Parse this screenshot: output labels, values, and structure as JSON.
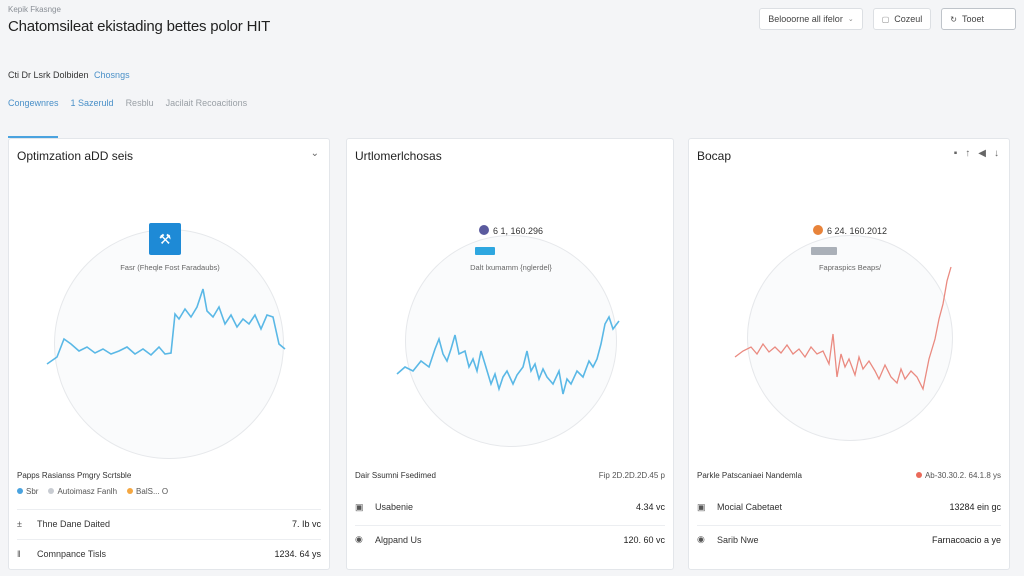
{
  "header": {
    "breadcrumb": "Kepik Fkasnge",
    "title": "Chatomsileat ekistading bettes polor HIT",
    "subline_text": "Cti Dr Lsrk Dolbiden",
    "subline_link": "Chosngs",
    "tabs": [
      "Congewnres",
      "1 Sazeruld",
      "Resblu",
      "Jacilait Recoacitions"
    ],
    "buttons": {
      "primary": "Belooorne all ifelor",
      "secondary": "Cozeul",
      "tertiary": "Tooet"
    }
  },
  "cards": [
    {
      "title": "Optimzation aDD seis",
      "center_label": "Fasr (Fheqle Fost Faradaubs)",
      "footer_title": "Papps Rasianss Pmgry Scrtsble",
      "legend": [
        "Sbr",
        "Autoimasz Fanlh",
        "BalS... O"
      ],
      "rows": [
        {
          "icon": "±",
          "label": "Thne Dane Daited",
          "value": "7. Ib vc"
        },
        {
          "icon": "‖",
          "label": "Comnpance Tisls",
          "value": "1234. 64 ys"
        }
      ]
    },
    {
      "title": "Urtlomerlchosas",
      "center_value": "6 1, 160.296",
      "center_label": "Dalt lxumamm {nglerdel}",
      "footer_title": "Dair Ssumni Fsedimed",
      "footer_right": "Fip 2D.2D.2D.45 p",
      "rows": [
        {
          "icon": "▣",
          "label": "Usabenie",
          "value": "4.34 vc"
        },
        {
          "icon": "◉",
          "label": "Algpand Us",
          "value": "120. 60 vc"
        }
      ]
    },
    {
      "title": "Bocap",
      "controls": [
        "▪",
        "↑",
        "◀",
        "↓"
      ],
      "center_value": "6 24. 160.2012",
      "center_label": "Fapraspics Beaps/",
      "footer_title": "Parkle Patscaniaei Nandemla",
      "footer_right": "Ab-30.30.2. 64.1.8 ys",
      "rows": [
        {
          "icon": "▣",
          "label": "Mocial Cabetaet",
          "value": "13284 ein gc"
        },
        {
          "icon": "◉",
          "label": "Sarib Nwe",
          "value": "Farnacoacio a ye"
        }
      ]
    }
  ],
  "colors": {
    "accent": "#4aa3df",
    "line_blue": "#5ab8e6",
    "line_red": "#ea8a80"
  }
}
